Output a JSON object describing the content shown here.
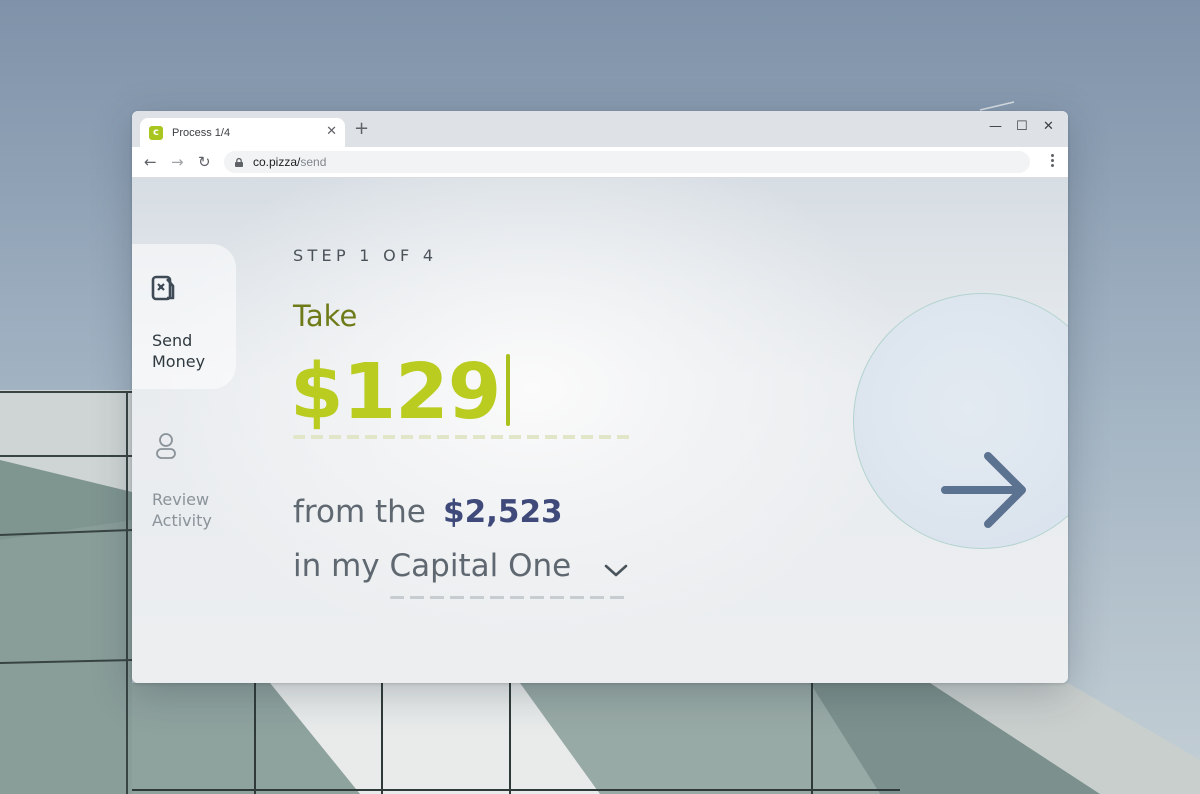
{
  "browser": {
    "tab_title": "Process 1/4",
    "tab_close": "✕",
    "new_tab": "+",
    "url_host": "co.pizza/",
    "url_path": "send",
    "controls": {
      "minimize": "—",
      "maximize": "☐",
      "close": "✕"
    },
    "nav": {
      "back": "←",
      "forward": "→",
      "reload": "↻"
    }
  },
  "sidebar": {
    "items": [
      {
        "label_line1": "Send",
        "label_line2": "Money",
        "icon": "money-transfer-icon",
        "active": true
      },
      {
        "label_line1": "Review",
        "label_line2": "Activity",
        "icon": "user-icon",
        "active": false
      }
    ]
  },
  "main": {
    "step": "STEP 1 OF 4",
    "take_label": "Take",
    "amount": "$129",
    "from_text": "from the",
    "balance": "$2,523",
    "in_my": "in my",
    "account": "Capital One"
  },
  "colors": {
    "accent": "#b9cc1f",
    "take": "#6f7b19",
    "balance": "#3f4a7a",
    "arrow": "#5b7290"
  }
}
